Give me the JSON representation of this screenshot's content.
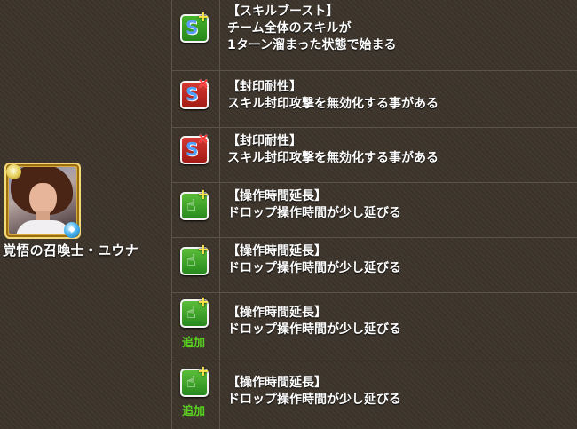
{
  "monster": {
    "name": "覚悟の召喚士・ユウナ",
    "attributes": [
      "light",
      "water"
    ]
  },
  "awakenings": [
    {
      "icon": "skill-boost-icon",
      "title": "【スキルブースト】",
      "lines": [
        "チーム全体のスキルが",
        "1ターン溜まった状態で始まる"
      ],
      "added": ""
    },
    {
      "icon": "skill-seal-resist-icon",
      "title": "【封印耐性】",
      "lines": [
        "スキル封印攻撃を無効化する事がある"
      ],
      "added": ""
    },
    {
      "icon": "skill-seal-resist-icon",
      "title": "【封印耐性】",
      "lines": [
        "スキル封印攻撃を無効化する事がある"
      ],
      "added": ""
    },
    {
      "icon": "time-extend-icon",
      "title": "【操作時間延長】",
      "lines": [
        "ドロップ操作時間が少し延びる"
      ],
      "added": ""
    },
    {
      "icon": "time-extend-icon",
      "title": "【操作時間延長】",
      "lines": [
        "ドロップ操作時間が少し延びる"
      ],
      "added": ""
    },
    {
      "icon": "time-extend-icon",
      "title": "【操作時間延長】",
      "lines": [
        "ドロップ操作時間が少し延びる"
      ],
      "added": "追加"
    },
    {
      "icon": "time-extend-icon",
      "title": "【操作時間延長】",
      "lines": [
        "ドロップ操作時間が少し延びる"
      ],
      "added": "追加"
    }
  ],
  "colors": {
    "background": "#3d352c",
    "divider": "#5c5347",
    "added": "#58d01f"
  }
}
